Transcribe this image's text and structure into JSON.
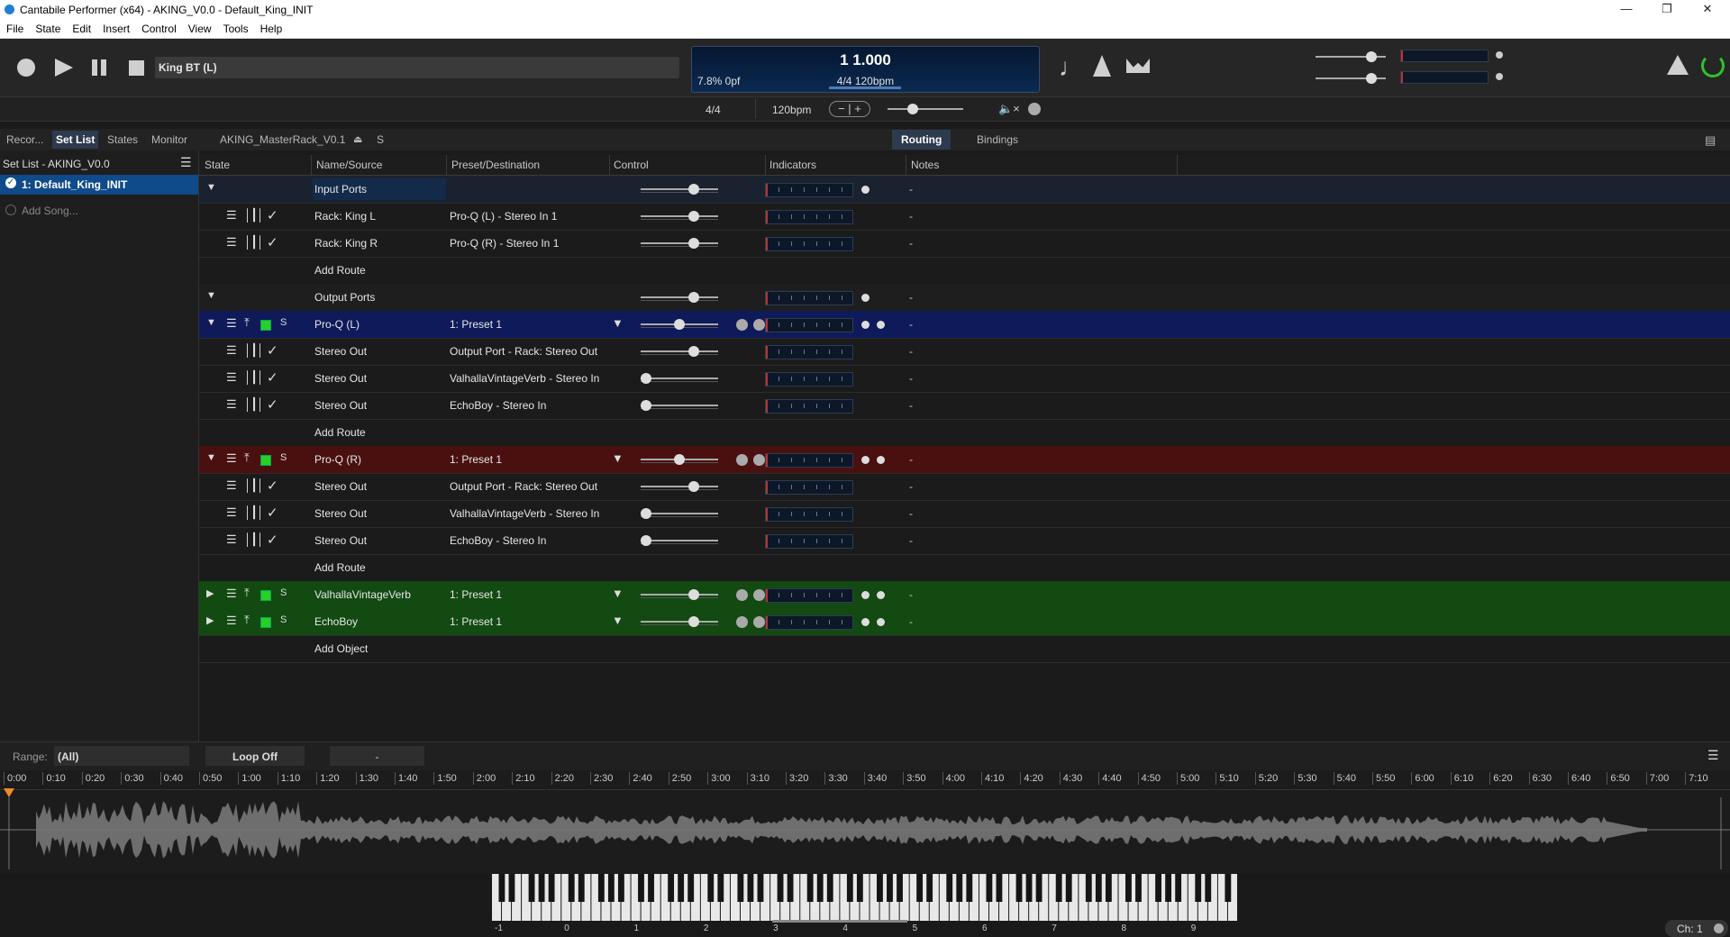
{
  "window": {
    "title": "Cantabile Performer (x64) - AKING_V0.0 - Default_King_INIT"
  },
  "menu": [
    "File",
    "State",
    "Edit",
    "Insert",
    "Control",
    "View",
    "Tools",
    "Help"
  ],
  "transport": {
    "song": "King BT (L)",
    "position": "1 1.000",
    "load": "7.8%  0pf",
    "timesig_tempo": "4/4 120bpm"
  },
  "subbar": {
    "timesig": "4/4",
    "tempo": "120bpm"
  },
  "left_tabs": [
    "Recor...",
    "Set List",
    "States",
    "Monitor"
  ],
  "rack_name": "AKING_MasterRack_V0.1",
  "rack_s": "S",
  "view_tabs": {
    "routing": "Routing",
    "bindings": "Bindings"
  },
  "setlist": {
    "header": "Set List - AKING_V0.0",
    "items": [
      "1: Default_King_INIT"
    ],
    "add": "Add Song..."
  },
  "columns": [
    "State",
    "Name/Source",
    "Preset/Destination",
    "Control",
    "Indicators",
    "Notes"
  ],
  "rows": [
    {
      "type": "group",
      "name": "Input Ports",
      "preset": "",
      "note": "-",
      "knob": 0.72,
      "bg": "#1a2230"
    },
    {
      "type": "route",
      "name": "Rack: King L",
      "preset": "Pro-Q (L) - Stereo In 1",
      "note": "-",
      "knob": 0.72
    },
    {
      "type": "route",
      "name": "Rack: King R",
      "preset": "Pro-Q (R) - Stereo In 1",
      "note": "-",
      "knob": 0.72
    },
    {
      "type": "add",
      "name": "Add Route",
      "preset": "",
      "note": ""
    },
    {
      "type": "group",
      "name": "Output Ports",
      "preset": "",
      "note": "-",
      "knob": 0.72,
      "bg": "#1e1e1e"
    },
    {
      "type": "plugin",
      "name": "Pro-Q (L)",
      "preset": "1: Preset 1",
      "note": "-",
      "knob": 0.5,
      "bg": "#0f1a5a",
      "open": true
    },
    {
      "type": "route",
      "name": "Stereo Out",
      "preset": "Output Port - Rack: Stereo Out",
      "note": "-",
      "knob": 0.72
    },
    {
      "type": "route",
      "name": "Stereo Out",
      "preset": "ValhallaVintageVerb - Stereo In",
      "note": "-",
      "knob": 0.0
    },
    {
      "type": "route",
      "name": "Stereo Out",
      "preset": "EchoBoy - Stereo In",
      "note": "-",
      "knob": 0.0
    },
    {
      "type": "add",
      "name": "Add Route",
      "preset": "",
      "note": ""
    },
    {
      "type": "plugin",
      "name": "Pro-Q (R)",
      "preset": "1: Preset 1",
      "note": "-",
      "knob": 0.5,
      "bg": "#4a1010",
      "open": true
    },
    {
      "type": "route",
      "name": "Stereo Out",
      "preset": "Output Port - Rack: Stereo Out",
      "note": "-",
      "knob": 0.72
    },
    {
      "type": "route",
      "name": "Stereo Out",
      "preset": "ValhallaVintageVerb - Stereo In",
      "note": "-",
      "knob": 0.0
    },
    {
      "type": "route",
      "name": "Stereo Out",
      "preset": "EchoBoy - Stereo In",
      "note": "-",
      "knob": 0.0
    },
    {
      "type": "add",
      "name": "Add Route",
      "preset": "",
      "note": ""
    },
    {
      "type": "plugin",
      "name": "ValhallaVintageVerb",
      "preset": "1: Preset 1",
      "note": "-",
      "knob": 0.72,
      "bg": "#124a12",
      "open": false
    },
    {
      "type": "plugin",
      "name": "EchoBoy",
      "preset": "1: Preset 1",
      "note": "-",
      "knob": 0.72,
      "bg": "#124a12",
      "open": false
    },
    {
      "type": "add",
      "name": "Add Object",
      "preset": "",
      "note": ""
    }
  ],
  "range": {
    "label": "Range:",
    "value": "(All)",
    "loop": "Loop Off",
    "marker": "-"
  },
  "timeline": [
    "0:00",
    "0:10",
    "0:20",
    "0:30",
    "0:40",
    "0:50",
    "1:00",
    "1:10",
    "1:20",
    "1:30",
    "1:40",
    "1:50",
    "2:00",
    "2:10",
    "2:20",
    "2:30",
    "2:40",
    "2:50",
    "3:00",
    "3:10",
    "3:20",
    "3:30",
    "3:40",
    "3:50",
    "4:00",
    "4:10",
    "4:20",
    "4:30",
    "4:40",
    "4:50",
    "5:00",
    "5:10",
    "5:20",
    "5:30",
    "5:40",
    "5:50",
    "6:00",
    "6:10",
    "6:20",
    "6:30",
    "6:40",
    "6:50",
    "7:00",
    "7:10"
  ],
  "keyboard": {
    "octaves": [
      "-1",
      "0",
      "1",
      "2",
      "3",
      "4",
      "5",
      "6",
      "7",
      "8",
      "9"
    ],
    "channel": "Ch: 1"
  }
}
